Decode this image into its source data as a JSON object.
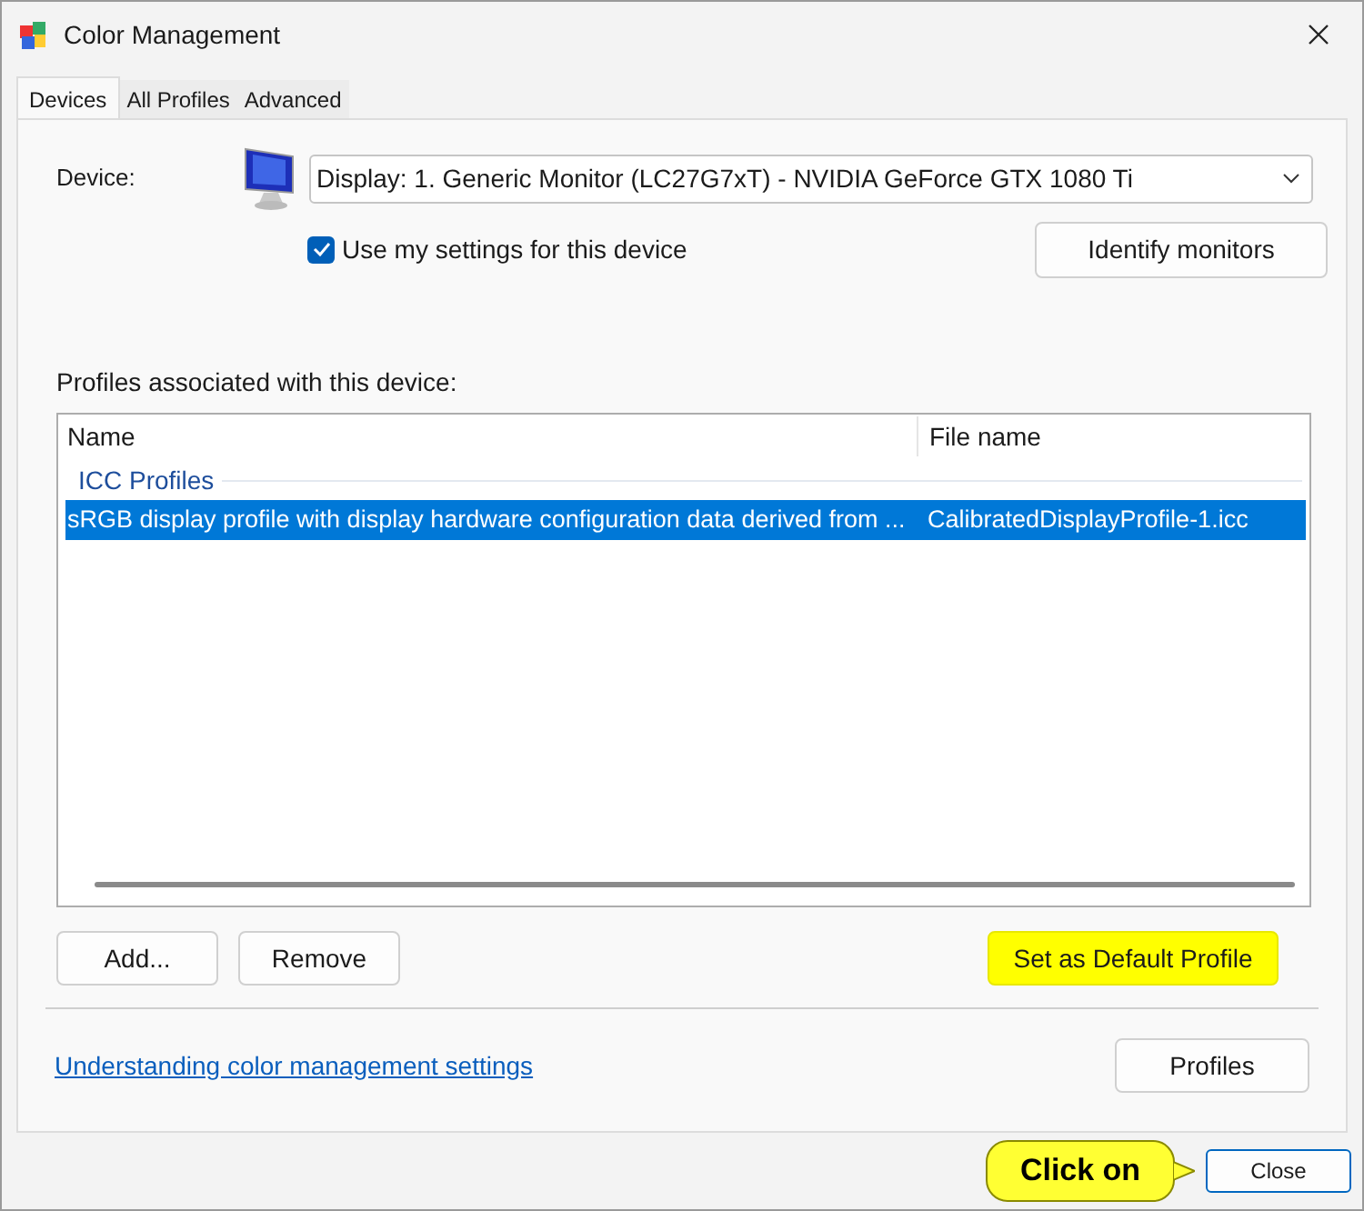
{
  "window": {
    "title": "Color Management"
  },
  "tabs": [
    {
      "label": "Devices",
      "selected": true
    },
    {
      "label": "All Profiles",
      "selected": false
    },
    {
      "label": "Advanced",
      "selected": false
    }
  ],
  "device": {
    "label": "Device:",
    "value": "Display: 1. Generic Monitor (LC27G7xT) - NVIDIA GeForce GTX 1080 Ti"
  },
  "use_my_settings": {
    "label": "Use my settings for this device",
    "checked": true
  },
  "identify_button": "Identify monitors",
  "profiles_label": "Profiles associated with this device:",
  "profiles_table": {
    "columns": [
      "Name",
      "File name"
    ],
    "groups": [
      {
        "label": "ICC Profiles",
        "rows": [
          {
            "name": "sRGB display profile with display hardware configuration data derived from ...",
            "file": "CalibratedDisplayProfile-1.icc",
            "selected": true
          }
        ]
      }
    ]
  },
  "list_buttons": [
    {
      "label": "Add...",
      "highlighted": false
    },
    {
      "label": "Remove",
      "highlighted": false
    },
    {
      "label": "Set as Default Profile",
      "highlighted": true
    }
  ],
  "link": "Understanding color management settings",
  "profiles_button": "Profiles",
  "close_button": "Close",
  "callout": "Click on"
}
